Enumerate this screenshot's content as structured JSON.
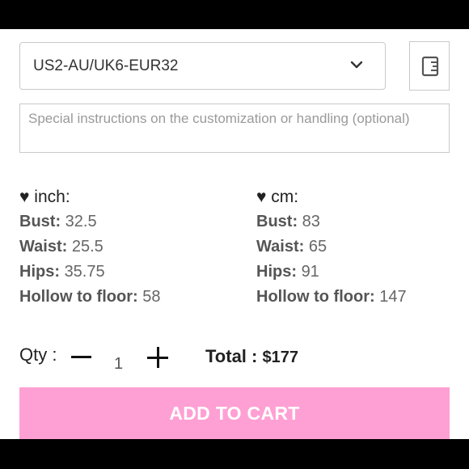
{
  "size_select": {
    "value": "US2-AU/UK6-EUR32",
    "icon": "chevron-down-icon"
  },
  "size_chart_button": {
    "icon": "ruler-icon"
  },
  "instructions": {
    "placeholder": "Special instructions on the customization or handling (optional)"
  },
  "measurements": {
    "inch": {
      "heading": "♥ inch:",
      "rows": [
        {
          "label": "Bust:",
          "value": "32.5"
        },
        {
          "label": "Waist:",
          "value": "25.5"
        },
        {
          "label": "Hips:",
          "value": "35.75"
        },
        {
          "label": "Hollow to floor:",
          "value": "58"
        }
      ]
    },
    "cm": {
      "heading": "♥ cm:",
      "rows": [
        {
          "label": "Bust:",
          "value": "83"
        },
        {
          "label": "Waist:",
          "value": "65"
        },
        {
          "label": "Hips:",
          "value": "91"
        },
        {
          "label": "Hollow to floor:",
          "value": "147"
        }
      ]
    }
  },
  "quantity": {
    "label": "Qty :",
    "value": "1"
  },
  "total": {
    "label": "Total :",
    "amount": "$177"
  },
  "cart": {
    "button_label": "ADD TO CART",
    "color": "#ffa0d4"
  }
}
